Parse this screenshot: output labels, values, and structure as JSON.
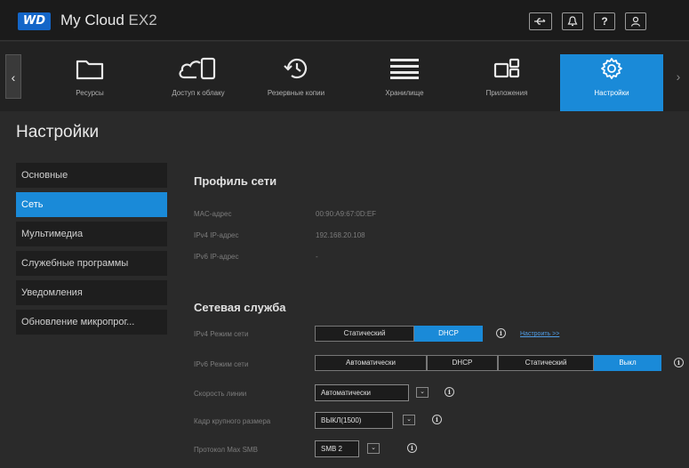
{
  "header": {
    "logo": "WD",
    "title_main": "My Cloud",
    "title_model": " EX2",
    "buttons": [
      {
        "name": "usb-icon",
        "glyph": "⇌"
      },
      {
        "name": "bell-icon",
        "glyph": "🔔"
      },
      {
        "name": "help-icon",
        "glyph": "?"
      },
      {
        "name": "user-icon",
        "glyph": "👤"
      }
    ]
  },
  "nav": {
    "items": [
      {
        "label": "Ресурсы",
        "icon": "folder-icon"
      },
      {
        "label": "Доступ к облаку",
        "icon": "cloud-device-icon"
      },
      {
        "label": "Резервные копии",
        "icon": "backup-icon"
      },
      {
        "label": "Хранилище",
        "icon": "storage-icon"
      },
      {
        "label": "Приложения",
        "icon": "apps-icon"
      },
      {
        "label": "Настройки",
        "icon": "gear-icon",
        "active": true
      }
    ],
    "prev": "‹",
    "next": "›"
  },
  "page_title": "Настройки",
  "sidebar": {
    "items": [
      {
        "label": "Основные"
      },
      {
        "label": "Сеть",
        "active": true
      },
      {
        "label": "Мультимедиа"
      },
      {
        "label": "Служебные программы"
      },
      {
        "label": "Уведомления"
      },
      {
        "label": "Обновление микропрог..."
      }
    ]
  },
  "network_profile": {
    "title": "Профиль сети",
    "rows": [
      {
        "label": "MAC-адрес",
        "value": "00:90:A9:67:0D:EF"
      },
      {
        "label": "IPv4 IP-адрес",
        "value": "192.168.20.108"
      },
      {
        "label": "IPv6 IP-адрес",
        "value": "-"
      }
    ]
  },
  "network_service": {
    "title": "Сетевая служба",
    "ipv4": {
      "label": "IPv4 Режим сети",
      "options": [
        "Статический",
        "DHCP"
      ],
      "selected": "DHCP",
      "link": "Настроить >>"
    },
    "ipv6": {
      "label": "IPv6 Режим сети",
      "options": [
        "Автоматически",
        "DHCP",
        "Статический",
        "Выкл"
      ],
      "selected": "Выкл"
    },
    "link_speed": {
      "label": "Скорость линии",
      "value": "Автоматически"
    },
    "jumbo": {
      "label": "Кадр крупного размера",
      "value": "ВЫКЛ(1500)"
    },
    "smb": {
      "label": "Протокол Max SMB",
      "value": "SMB 2"
    }
  },
  "colors": {
    "accent": "#1a8ad8",
    "background": "#2a2a2a",
    "link": "#4f9de6"
  }
}
